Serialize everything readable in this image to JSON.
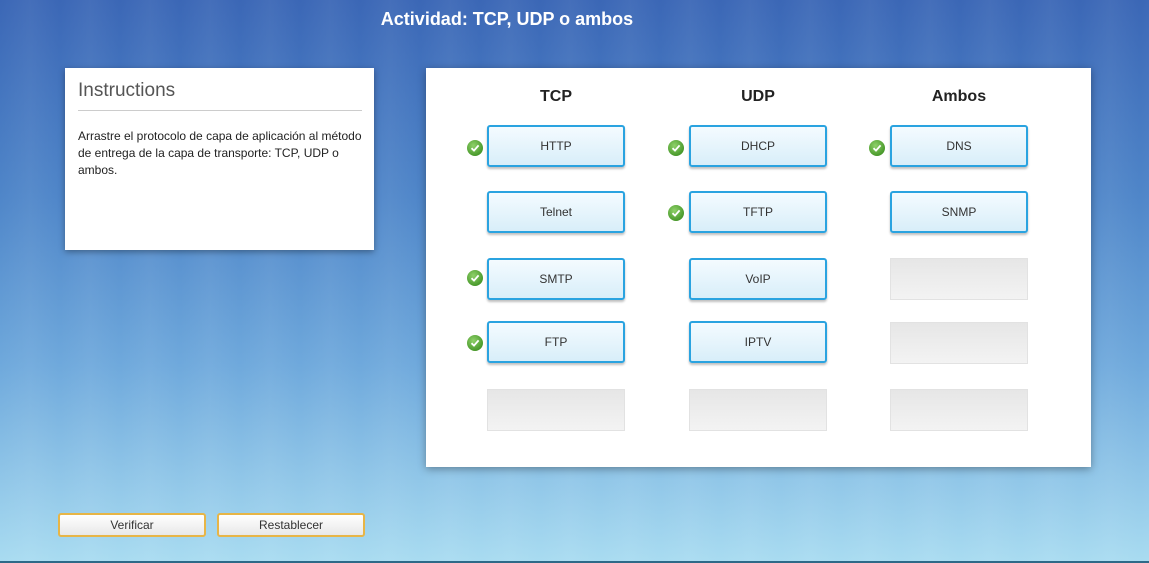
{
  "title": "Actividad: TCP, UDP o ambos",
  "instructions": {
    "heading": "Instructions",
    "text": "Arrastre el protocolo de capa de aplicación al método de entrega de la capa de transporte: TCP, UDP o ambos."
  },
  "columns": {
    "tcp": {
      "title": "TCP",
      "items": [
        {
          "label": "HTTP",
          "correct": true
        },
        {
          "label": "Telnet",
          "correct": false
        },
        {
          "label": "SMTP",
          "correct": true
        },
        {
          "label": "FTP",
          "correct": true
        }
      ]
    },
    "udp": {
      "title": "UDP",
      "items": [
        {
          "label": "DHCP",
          "correct": true
        },
        {
          "label": "TFTP",
          "correct": true
        },
        {
          "label": "VoIP",
          "correct": false
        },
        {
          "label": "IPTV",
          "correct": false
        }
      ]
    },
    "both": {
      "title": "Ambos",
      "items": [
        {
          "label": "DNS",
          "correct": true
        },
        {
          "label": "SNMP",
          "correct": false
        }
      ]
    }
  },
  "buttons": {
    "verify": "Verificar",
    "reset": "Restablecer"
  },
  "colors": {
    "chip_border": "#2aa3e0",
    "check_green": "#4a9a2c",
    "button_border": "#e7b547"
  }
}
